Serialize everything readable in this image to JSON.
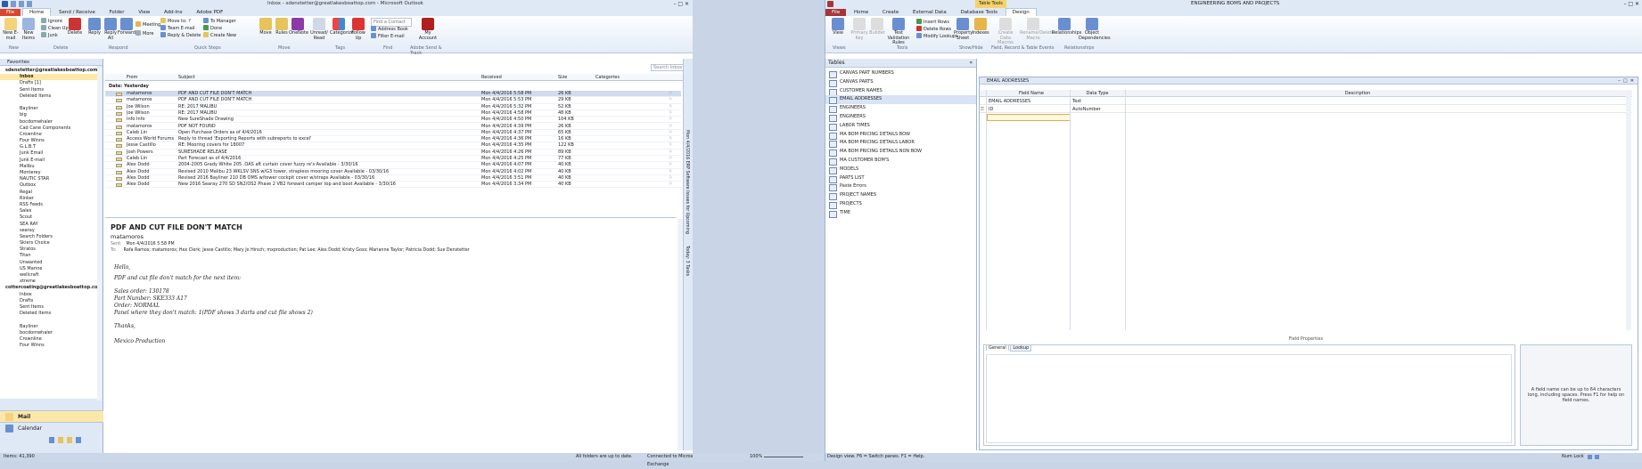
{
  "outlook": {
    "title": "Inbox - sdenstetter@greatlakesboattop.com - Microsoft Outlook",
    "file_tab": "File",
    "tabs": [
      "Home",
      "Send / Receive",
      "Folder",
      "View",
      "Add-Ins",
      "Adobe PDF"
    ],
    "ribbon": {
      "new_email": "New E-mail",
      "new_items": "New Items",
      "ignore": "Ignore",
      "clean_up": "Clean Up",
      "junk": "Junk",
      "delete": "Delete",
      "reply": "Reply",
      "reply_all": "Reply All",
      "forward": "Forward",
      "meeting": "Meeting",
      "more": "More",
      "move_to": "Move to: ?",
      "team_email": "Team E-mail",
      "reply_delete": "Reply & Delete",
      "to_manager": "To Manager",
      "done": "Done",
      "create_new": "Create New",
      "move": "Move",
      "rules": "Rules",
      "onenote": "OneNote",
      "unread_read": "Unread/ Read",
      "categorize": "Categorize",
      "follow_up": "Follow Up",
      "find_contact": "Find a Contact",
      "address_book": "Address Book",
      "filter_email": "Filter E-mail",
      "my_account": "My Account",
      "groups": [
        "New",
        "Delete",
        "Respond",
        "Quick Steps",
        "Move",
        "Tags",
        "Find",
        "Adobe Send & Track"
      ]
    },
    "nav": {
      "favorites": "Favorites",
      "account1": "sdenstetter@greatlakesboattop.com",
      "account1_items": [
        "Inbox",
        "Drafts [1]",
        "Sent Items",
        "Deleted Items",
        "",
        "Bayliner",
        "big",
        "bocdomwhaler",
        "Cad Cane Components",
        "Crownline",
        "Four Winns",
        "G.L.B.T",
        "Junk Email",
        "Junk E-mail",
        "Malibu",
        "Monterey",
        "NAUTIC STAR",
        "Outbox",
        "Regal",
        "Rinker",
        "RSS Feeds",
        "Sales",
        "Scout",
        "SEA RAY",
        "searay",
        "Search Folders",
        "Skiers Choice",
        "Stratos",
        "Titan",
        "Unwanted",
        "US Marine",
        "wellcraft",
        "xtreme"
      ],
      "account2": "cottercoating@greatlakesboattop.com",
      "account2_items": [
        "Inbox",
        "Drafts",
        "Sent Items",
        "Deleted Items",
        "",
        "Bayliner",
        "bocdomwhaler",
        "Crownline",
        "Four Winns"
      ],
      "mail": "Mail",
      "calendar": "Calendar"
    },
    "search_placeholder": "Search Inbox (Ctrl+E)",
    "columns": {
      "from": "From",
      "subject": "Subject",
      "received": "Received",
      "size": "Size",
      "categories": "Categories"
    },
    "date_group": "Date: Yesterday",
    "messages": [
      {
        "from": "matamoros",
        "subject": "PDF AND CUT FILE DON'T MATCH",
        "received": "Mon 4/4/2016 5:58 PM",
        "size": "26 KB"
      },
      {
        "from": "matamoros",
        "subject": "PDF AND CUT FILE DON'T MATCH",
        "received": "Mon 4/4/2016 5:53 PM",
        "size": "29 KB"
      },
      {
        "from": "Joe Wilson",
        "subject": "RE: 2017 MALIBU",
        "received": "Mon 4/4/2016 5:32 PM",
        "size": "52 KB"
      },
      {
        "from": "Joe Wilson",
        "subject": "RE: 2017 MALIBU",
        "received": "Mon 4/4/2016 4:58 PM",
        "size": "48 KB"
      },
      {
        "from": "Info Info",
        "subject": "New SureShade Drawing",
        "received": "Mon 4/4/2016 4:50 PM",
        "size": "104 KB"
      },
      {
        "from": "matamoros",
        "subject": "PDF NOT FOUND",
        "received": "Mon 4/4/2016 4:39 PM",
        "size": "26 KB"
      },
      {
        "from": "Caleb Lin",
        "subject": "Open Purchase Orders as of 4/4/2016",
        "received": "Mon 4/4/2016 4:37 PM",
        "size": "65 KB"
      },
      {
        "from": "Access World Forums",
        "subject": "Reply to thread 'Exporting Reports with subreports to excel'",
        "received": "Mon 4/4/2016 4:36 PM",
        "size": "16 KB"
      },
      {
        "from": "Jesse Castillo",
        "subject": "RE: Mooring covers for 18007",
        "received": "Mon 4/4/2016 4:35 PM",
        "size": "122 KB"
      },
      {
        "from": "Josh Powers",
        "subject": "SURESHADE RELEASE",
        "received": "Mon 4/4/2016 4:26 PM",
        "size": "89 KB"
      },
      {
        "from": "Caleb Lin",
        "subject": "Part Forecast as of 4/4/2016",
        "received": "Mon 4/4/2016 4:25 PM",
        "size": "77 KB"
      },
      {
        "from": "Alex Dodd",
        "subject": "2004-2005 Grady White 205 .OAS aft curtain cover fuzzy re's Available - 3/30/16",
        "received": "Mon 4/4/2016 4:07 PM",
        "size": "40 KB"
      },
      {
        "from": "Alex Dodd",
        "subject": "Revised 2010 Malibu 23 WKLSV SNS w/G3 tower, strapless mooring cover Available - 03/30/16",
        "received": "Mon 4/4/2016 4:02 PM",
        "size": "40 KB"
      },
      {
        "from": "Alex Dodd",
        "subject": "Revised 2016 Bayliner 210 DB OMS w/tower cockpit cover w/straps Available - 03/30/16",
        "received": "Mon 4/4/2016 3:51 PM",
        "size": "40 KB"
      },
      {
        "from": "Alex Dodd",
        "subject": "New 2016 Searay 270 SD SN2/OS2 Phase 2 VB2 forward camper top and boot Available - 3/30/16",
        "received": "Mon 4/4/2016 3:34 PM",
        "size": "40 KB"
      }
    ],
    "reading": {
      "subject": "PDF AND CUT FILE DON'T MATCH",
      "sender": "matamoros",
      "sent_label": "Sent:",
      "sent_value": "Mon 4/4/2016 5:58 PM",
      "to_label": "To:",
      "to_value": "Rafa Ramos; matamoros; Hex Clerk; Jesse Castillo; Mary Jo Hirsch; mxproduction; Pat Lee; Alex Dodd; Kristy Goss; Marianne Taylor; Patricia Dodd; Sue Denstetter",
      "body": [
        "Hello,",
        "PDF and cut file don't match for the next item:",
        "Sales order: 130178",
        "Part Number: SKE333 A17",
        "Order: NORMAL",
        "Panel where they don't match: 1(PDF shows 3 darts and cut file shows 2)",
        "Thanks,",
        "Mexico Production"
      ]
    },
    "todo_bar": "Mon 4/4/2016 ERP Software Issues for Upcoming",
    "todo_bar2": "Today: 3 Tasks",
    "status": {
      "items": "Items: 41,390",
      "sync": "All folders are up to date.",
      "exchange": "Connected to Microsoft Exchange",
      "zoom": "100%"
    }
  },
  "access": {
    "title": "ENGINEERING BOMS AND PROJECTS",
    "context_tab": "Table Tools",
    "file_tab": "File",
    "tabs": [
      "Home",
      "Create",
      "External Data",
      "Database Tools",
      "Design"
    ],
    "ribbon": {
      "view": "View",
      "primary_key": "Primary Key",
      "builder": "Builder",
      "test_rules": "Test Validation Rules",
      "insert_rows": "Insert Rows",
      "delete_rows": "Delete Rows",
      "modify_lookups": "Modify Lookups",
      "property_sheet": "Property Sheet",
      "indexes": "Indexes",
      "create_data_macros": "Create Data Macros",
      "rename_macro": "Rename/Delete Macro",
      "relationships": "Relationships",
      "object_dependencies": "Object Dependencies",
      "groups": [
        "Views",
        "Tools",
        "Show/Hide",
        "Field, Record & Table Events",
        "Relationships"
      ]
    },
    "nav_title": "Tables",
    "tables": [
      "CANVAS PART NUMBERS",
      "CANVAS PARTS",
      "CUSTOMER NAMES",
      "EMAIL ADDRESSES",
      "ENGINEERS",
      "ENGINEERS",
      "LABOR TIMES",
      "MA BOM PRICING DETAILS BOW",
      "MA BOM PRICING DETAILS LABOR",
      "MA BOM PRICING DETAILS NON BOW",
      "MA CUSTOMER BOM'S",
      "MODELS",
      "PARTS LIST",
      "Paste Errors",
      "PROJECT NAMES",
      "PROJECTS",
      "TIME"
    ],
    "doc_tab": "EMAIL ADDRESSES",
    "grid_headers": {
      "field": "Field Name",
      "type": "Data Type",
      "desc": "Description"
    },
    "fields": [
      {
        "name": "EMAIL ADDRESSES",
        "type": "Text"
      },
      {
        "name": "ID",
        "type": "AutoNumber"
      }
    ],
    "field_properties": "Field Properties",
    "prop_tabs": [
      "General",
      "Lookup"
    ],
    "help": "A field name can be up to 64 characters long, including spaces. Press F1 for help on field names.",
    "status": "Design view.  F6 = Switch panes.  F1 = Help.",
    "numlock": "Num Lock"
  },
  "colors": {
    "accent": "#d0e0f5",
    "file_outlook": "#d9462b",
    "file_access": "#a4373a"
  }
}
